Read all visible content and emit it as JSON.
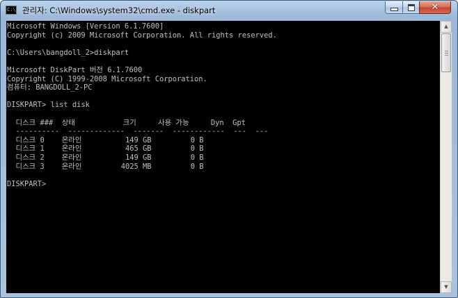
{
  "window": {
    "title": "관리자: C:\\Windows\\system32\\cmd.exe - diskpart",
    "icon": "cmd-icon",
    "icon_glyph": "C:\\",
    "controls": {
      "minimize": "minimize-icon",
      "maximize": "maximize-icon",
      "close": "close-icon",
      "close_glyph": "✕"
    }
  },
  "console": {
    "text_color": "#c0c0c0",
    "background": "#000000",
    "lines": [
      "Microsoft Windows [Version 6.1.7600]",
      "Copyright (c) 2009 Microsoft Corporation. All rights reserved.",
      "",
      "C:\\Users\\bangdoll_2>diskpart",
      "",
      "Microsoft DiskPart 버전 6.1.7600",
      "Copyright (C) 1999-2008 Microsoft Corporation.",
      "컴퓨터: BANGDOLL_2-PC",
      "",
      "DISKPART> list disk",
      "",
      "  디스크 ###  상태           크기     사용 가능     Dyn  Gpt",
      "  ----------  -------------  -------  ------------  ---  ---",
      "  디스크 0    온라인          149 GB         0 B",
      "  디스크 1    온라인          465 GB         0 B",
      "  디스크 2    온라인          149 GB         0 B",
      "  디스크 3    온라인         4025 MB         0 B",
      "",
      "DISKPART> "
    ]
  },
  "scrollbar": {
    "up_glyph": "▲",
    "down_glyph": "▼"
  }
}
